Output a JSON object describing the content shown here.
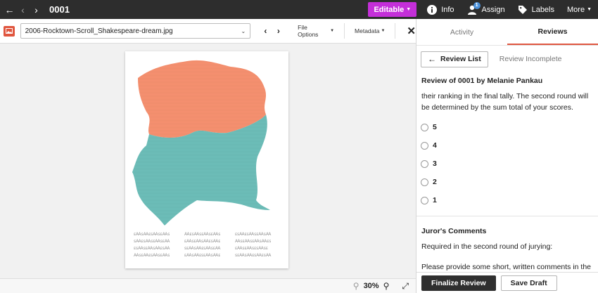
{
  "topbar": {
    "title": "0001",
    "editable_label": "Editable",
    "info_label": "Info",
    "assign_label": "Assign",
    "assign_badge": "1",
    "labels_label": "Labels",
    "more_label": "More"
  },
  "viewer_toolbar": {
    "file_name": "2006-Rocktown-Scroll_Shakespeare-dream.jpg",
    "file_options_label": "File Options",
    "metadata_label": "Metadata"
  },
  "viewer": {
    "zoom_level": "30%"
  },
  "tabs": [
    {
      "label": "Activity"
    },
    {
      "label": "Reviews"
    }
  ],
  "review": {
    "list_button": "Review List",
    "status": "Review Incomplete",
    "heading": "Review of 0001 by Melanie Pankau",
    "intro_text": "their ranking in the final tally. The second round will be determined by the sum total of your scores.",
    "options": [
      "5",
      "4",
      "3",
      "2",
      "1"
    ],
    "comments_heading": "Juror's Comments",
    "comments_p1": "Required in the second round of jurying:",
    "comments_p2": "Please provide some short, written comments in the",
    "finalize_label": "Finalize Review",
    "save_draft_label": "Save Draft"
  },
  "colors": {
    "topbar_bg": "#2d2d2d",
    "editable_accent": "#c42fd9",
    "active_tab_accent": "#e0563f",
    "artwork_top": "#f99271",
    "artwork_bottom": "#6ec0bb"
  }
}
